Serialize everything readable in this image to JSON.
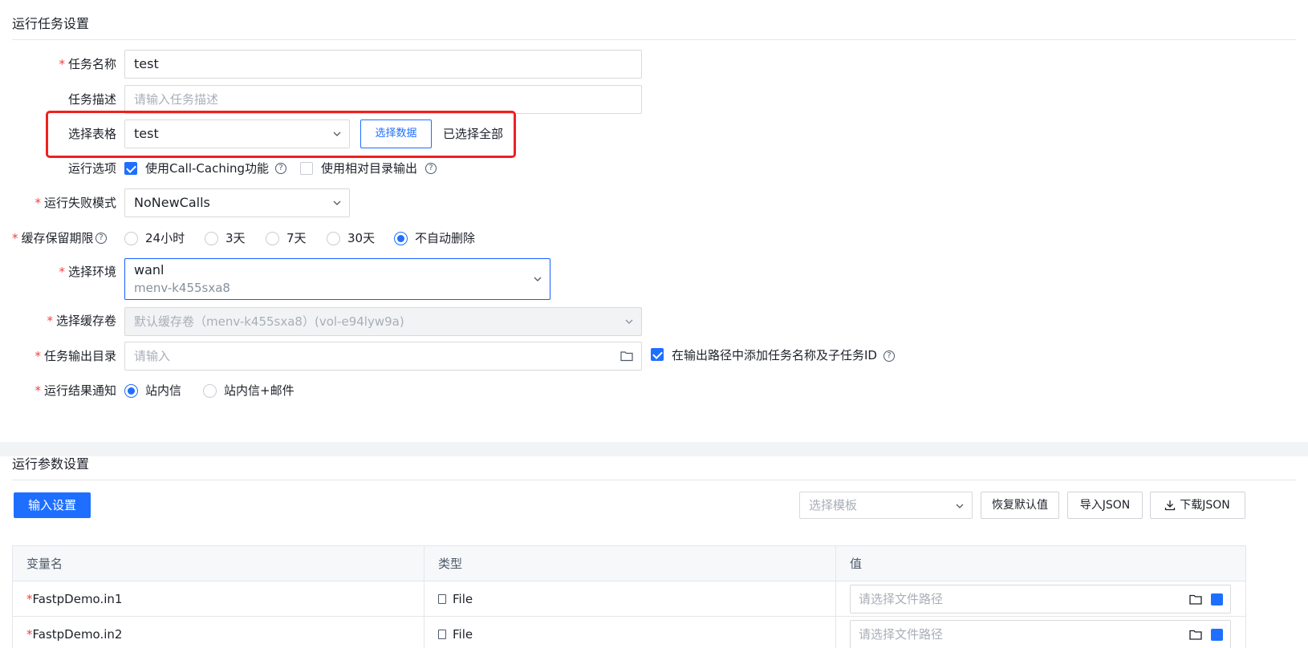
{
  "task_section": {
    "title": "运行任务设置",
    "task_name": {
      "label": "任务名称",
      "value": "test"
    },
    "task_desc": {
      "label": "任务描述",
      "placeholder": "请输入任务描述"
    },
    "table_select": {
      "label": "选择表格",
      "value": "test",
      "select_data_button": "选择数据",
      "status": "已选择全部"
    },
    "run_options": {
      "label": "运行选项",
      "call_caching": {
        "label": "使用Call-Caching功能",
        "checked": true
      },
      "relative_dir": {
        "label": "使用相对目录输出",
        "checked": false
      }
    },
    "failure_mode": {
      "label": "运行失败模式",
      "value": "NoNewCalls"
    },
    "cache_retention": {
      "label": "缓存保留期限",
      "options": [
        "24小时",
        "3天",
        "7天",
        "30天",
        "不自动删除"
      ],
      "selected": "不自动删除"
    },
    "environment": {
      "label": "选择环境",
      "name": "wanl",
      "id": "menv-k455sxa8"
    },
    "cache_volume": {
      "label": "选择缓存卷",
      "value": "默认缓存卷（menv-k455sxa8）(vol-e94lyw9a)"
    },
    "output_dir": {
      "label": "任务输出目录",
      "placeholder": "请输入",
      "append_label": "在输出路径中添加任务名称及子任务ID",
      "append_checked": true
    },
    "notification": {
      "label": "运行结果通知",
      "options": [
        "站内信",
        "站内信+邮件"
      ],
      "selected": "站内信"
    }
  },
  "params_section": {
    "title": "运行参数设置",
    "input_settings_button": "输入设置",
    "template_select": {
      "placeholder": "选择模板"
    },
    "restore_default_button": "恢复默认值",
    "import_json_button": "导入JSON",
    "download_json_button": "下载JSON",
    "table": {
      "headers": [
        "变量名",
        "类型",
        "值"
      ],
      "rows": [
        {
          "name": "FastpDemo.in1",
          "required": true,
          "type": "File",
          "placeholder": "请选择文件路径"
        },
        {
          "name": "FastpDemo.in2",
          "required": true,
          "type": "File",
          "placeholder": "请选择文件路径"
        }
      ]
    }
  },
  "colors": {
    "accent": "#1e6fff",
    "required": "#f53f3f",
    "highlight_box": "#f02020"
  },
  "icons": [
    "chevron-down-icon",
    "help-icon",
    "folder-icon",
    "download-icon",
    "file-icon",
    "edit-icon"
  ]
}
